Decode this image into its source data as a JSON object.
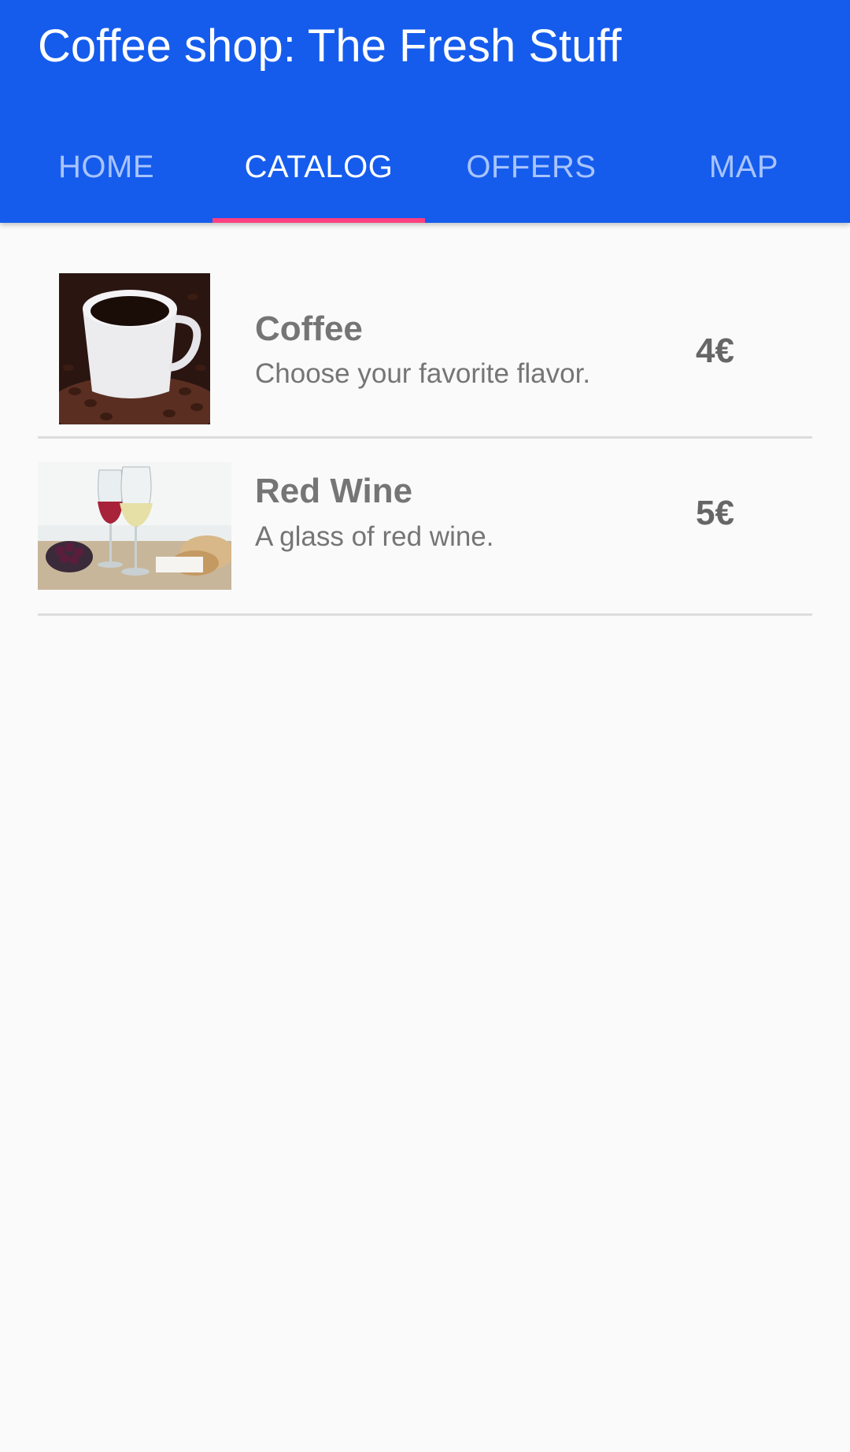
{
  "app": {
    "title": "Coffee shop: The Fresh Stuff"
  },
  "tabs": [
    {
      "label": "HOME",
      "selected": false
    },
    {
      "label": "CATALOG",
      "selected": true
    },
    {
      "label": "OFFERS",
      "selected": false
    },
    {
      "label": "MAP",
      "selected": false
    }
  ],
  "colors": {
    "appbar": "#155ced",
    "tab_active": "#ffffff",
    "tab_inactive": "#a8c4ff",
    "indicator": "#ff4081",
    "text": "#757575",
    "background": "#fafafa"
  },
  "catalog": {
    "items": [
      {
        "name": "Coffee",
        "description": "Choose your favorite flavor.",
        "price": "4€",
        "image": "coffee-cup-image"
      },
      {
        "name": "Red Wine",
        "description": "A glass of red wine.",
        "price": "5€",
        "image": "wine-glasses-image"
      }
    ]
  }
}
